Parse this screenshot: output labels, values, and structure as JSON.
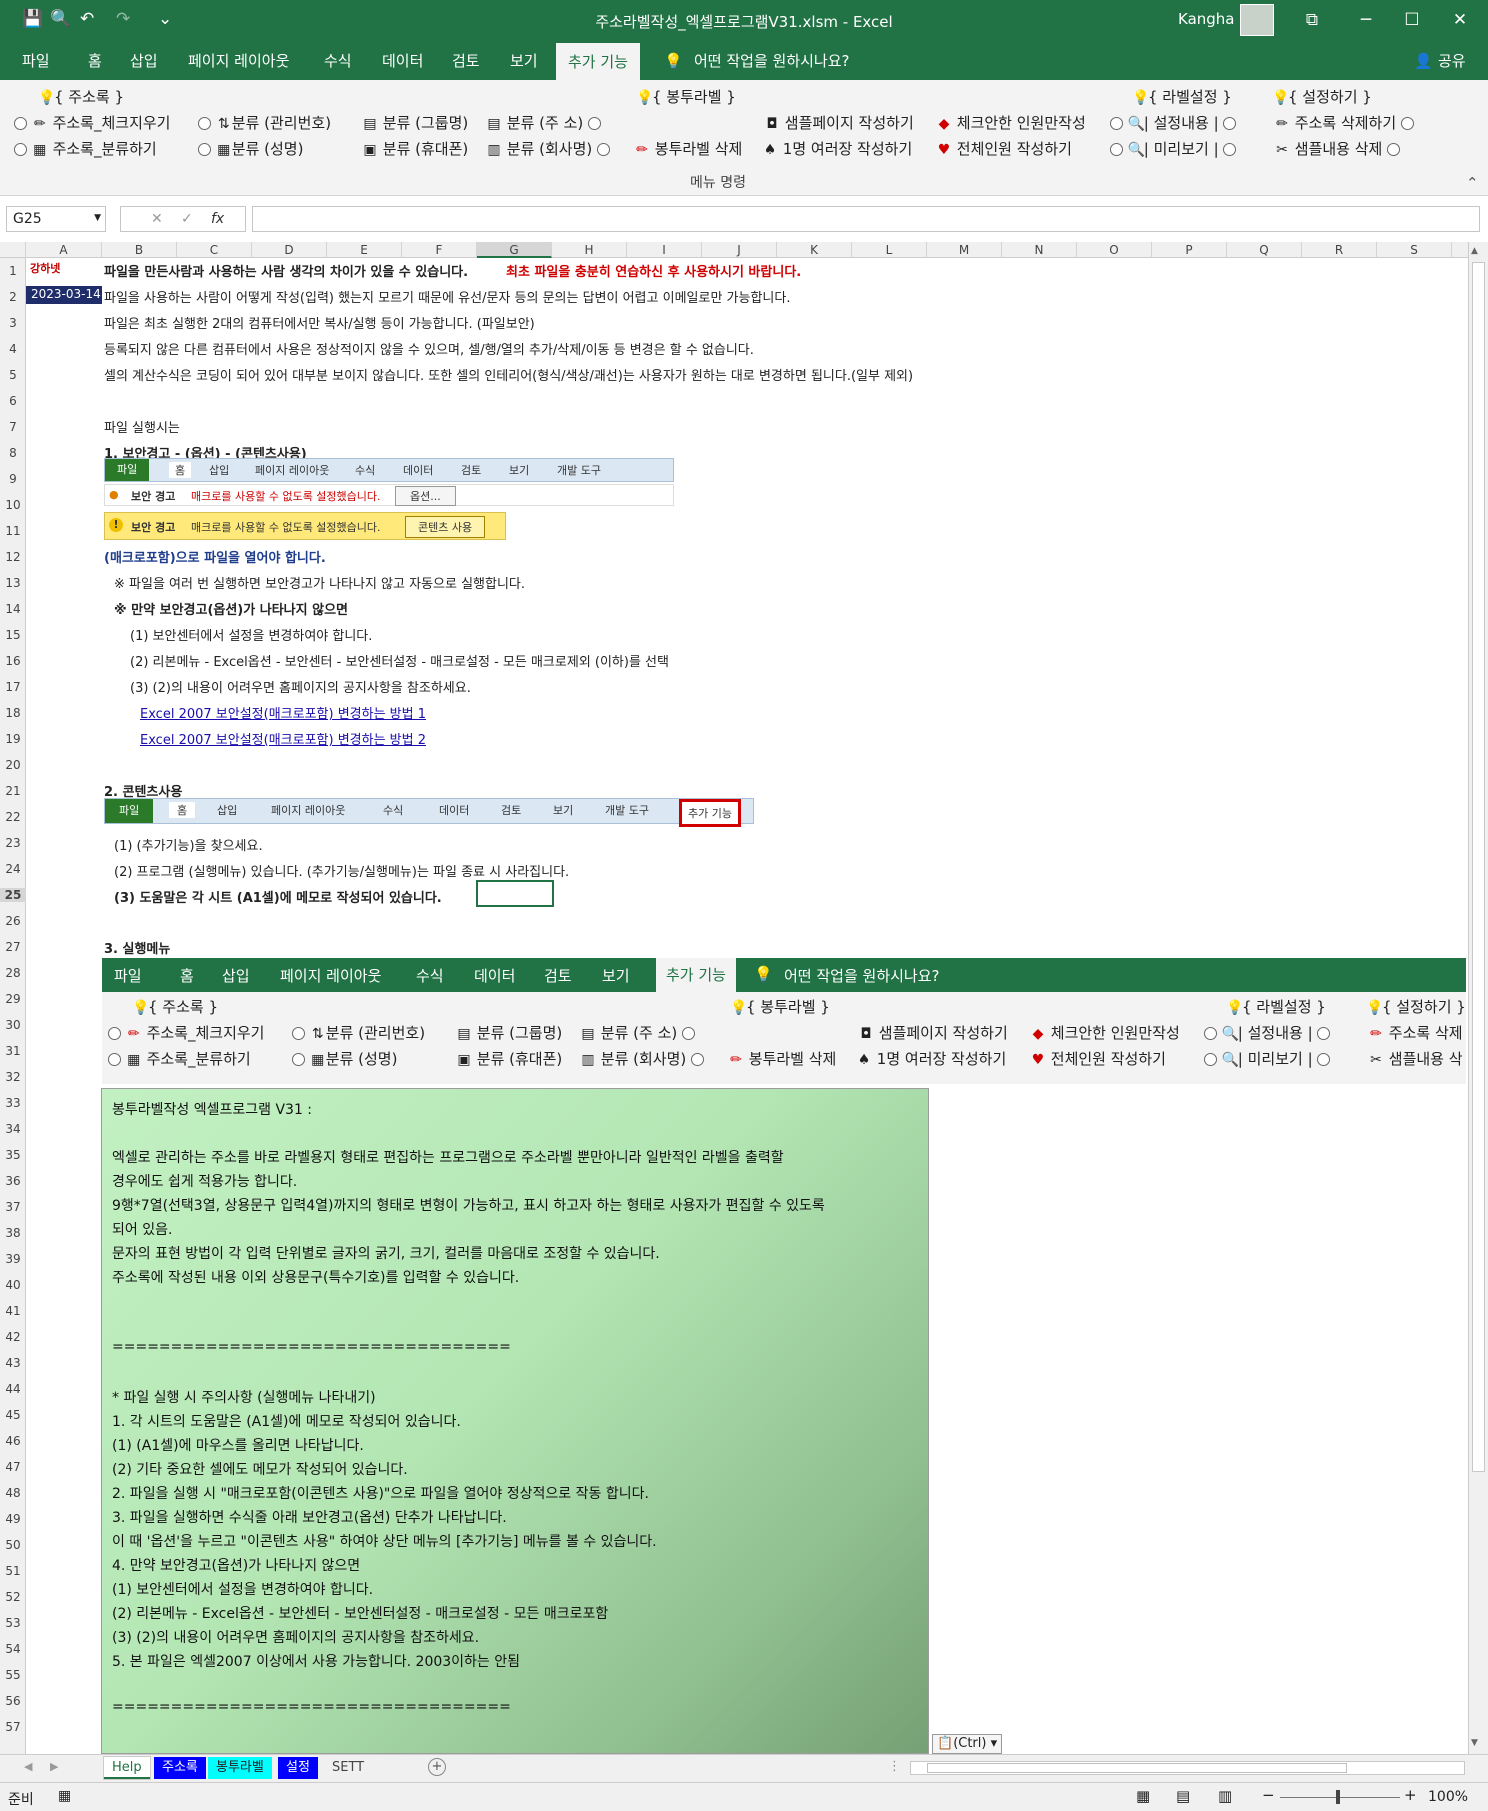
{
  "window": {
    "title": "주소라벨작성_엑셀프로그램V31.xlsm  -  Excel",
    "user": "Kangha",
    "minimize": "─",
    "maximize": "☐",
    "close": "✕",
    "ribbon_display": "⧉"
  },
  "quick_access": {
    "save": "💾",
    "preview": "🔍",
    "undo": "↶",
    "redo": "↷",
    "customize": "⌄"
  },
  "ribbon_tabs": [
    "파일",
    "홈",
    "삽입",
    "페이지 레이아웃",
    "수식",
    "데이터",
    "검토",
    "보기",
    "추가 기능"
  ],
  "tell_me": "어떤 작업을 원하시나요?",
  "share": "공유",
  "ribbon": {
    "group_headers": [
      "{ 주소록 }",
      "{ 봉투라벨 }",
      "{ 라벨설정 }",
      "{ 설정하기 }"
    ],
    "row1": [
      "주소록_체크지우기",
      "분류 (관리번호)",
      "분류 (그룹명)",
      "분류 (주    소)",
      "샘플페이지 작성하기",
      "체크안한 인원만작성",
      "| 설정내용 |",
      "주소록 삭제하기"
    ],
    "row2": [
      "주소록_분류하기",
      "분류 (성명)",
      "분류 (휴대폰)",
      "분류 (회사명)",
      "봉투라벨 삭제",
      "1명 여러장 작성하기",
      "전체인원 작성하기",
      "| 미리보기 |",
      "샘플내용 삭제"
    ],
    "group_label": "메뉴 명령"
  },
  "formula_bar": {
    "name_box": "G25",
    "cancel": "✕",
    "enter": "✓",
    "fx": "fx",
    "value": ""
  },
  "columns": [
    "A",
    "B",
    "C",
    "D",
    "E",
    "F",
    "G",
    "H",
    "I",
    "J",
    "K",
    "L",
    "M",
    "N",
    "O",
    "P",
    "Q",
    "R",
    "S"
  ],
  "rows": [
    "1",
    "2",
    "3",
    "4",
    "5",
    "6",
    "7",
    "8",
    "9",
    "10",
    "11",
    "12",
    "13",
    "14",
    "15",
    "16",
    "17",
    "18",
    "19",
    "20",
    "21",
    "22",
    "23",
    "24",
    "25",
    "26",
    "27",
    "28",
    "29",
    "30",
    "31",
    "32",
    "33",
    "34",
    "35",
    "36",
    "37",
    "38",
    "39",
    "40",
    "41",
    "42",
    "43",
    "44",
    "45",
    "46",
    "47",
    "48",
    "49",
    "50",
    "51",
    "52",
    "53",
    "54",
    "55",
    "56",
    "57"
  ],
  "sheet": {
    "logo": "강하넷",
    "date": "2023-03-14",
    "r1": "파일을 만든사람과 사용하는 사람 생각의 차이가 있을 수 있습니다.",
    "r1_red": "최초 파일을 충분히 연습하신 후 사용하시기 바랍니다.",
    "r2": "파일을 사용하는 사람이 어떻게 작성(입력) 했는지 모르기 때문에 유선/문자 등의 문의는 답변이 어렵고 이메일로만 가능합니다.",
    "r3": "파일은 최초 실행한 2대의 컴퓨터에서만 복사/실행 등이 가능합니다.  (파일보안)",
    "r4": "등록되지 않은 다른 컴퓨터에서 사용은 정상적이지 않을 수 있으며, 셀/행/열의 추가/삭제/이동 등 변경은 할 수 없습니다.",
    "r5": "셀의 계산수식은 코딩이 되어 있어 대부분 보이지 않습니다. 또한 셀의 인테리어(형식/색상/괘선)는 사용자가 원하는 대로 변경하면 됩니다.(일부 제외)",
    "r7": "파일 실행시는",
    "r8": "1. 보안경고 - (옵션) - (콘텐츠사용)",
    "mini1_tabs": [
      "파일",
      "홈",
      "삽입",
      "페이지 레이아웃",
      "수식",
      "데이터",
      "검토",
      "보기",
      "개발 도구"
    ],
    "mini1_warn": "보안 경고",
    "mini1_msg": "매크로를 사용할 수 없도록 설정했습니다.",
    "mini1_btn": "옵션...",
    "mini2_warn": "보안 경고",
    "mini2_msg": "매크로를 사용할 수 없도록 설정했습니다.",
    "mini2_btn": "콘텐츠 사용",
    "r12": "(매크로포함)으로 파일을 열어야 합니다.",
    "r13": "※ 파일을 여러 번 실행하면 보안경고가 나타나지 않고 자동으로 실행합니다.",
    "r14": "※ 만약 보안경고(옵션)가 나타나지 않으면",
    "r15": "(1) 보안센터에서 설정을 변경하여야 합니다.",
    "r16": "(2) 리본메뉴 - Excel옵션 - 보안센터 - 보안센터설정 - 매크로설정 - 모든 매크로제외 (이하)를 선택",
    "r17": "(3) (2)의 내용이 어려우면 홈페이지의 공지사항을 참조하세요.",
    "r18": "Excel 2007 보안설정(매크로포함) 변경하는 방법 1",
    "r19": "Excel 2007 보안설정(매크로포함) 변경하는 방법 2",
    "r21": "2. 콘텐츠사용",
    "mini3_tabs": [
      "파일",
      "홈",
      "삽입",
      "페이지 레이아웃",
      "수식",
      "데이터",
      "검토",
      "보기",
      "개발 도구",
      "추가 기능"
    ],
    "r23": "(1) (추가기능)을 찾으세요.",
    "r24": "(2) 프로그램 (실행메뉴) 있습니다. (추가기능/실행메뉴)는 파일 종료 시 사라집니다.",
    "r25": "(3) 도움말은 각 시트 (A1셀)에 메모로 작성되어 있습니다.",
    "r27": "3. 실행메뉴",
    "emb_tabs": [
      "파일",
      "홈",
      "삽입",
      "페이지 레이아웃",
      "수식",
      "데이터",
      "검토",
      "보기",
      "추가 기능"
    ],
    "emb_tell": "어떤 작업을 원하시나요?",
    "emb_headers": [
      "{ 주소록 }",
      "{ 봉투라벨 }",
      "{ 라벨설정 }",
      "{ 설정하기 }"
    ],
    "emb_row1": [
      "주소록_체크지우기",
      "분류 (관리번호)",
      "분류 (그룹명)",
      "분류 (주    소)",
      "샘플페이지 작성하기",
      "체크안한 인원만작성",
      "| 설정내용 |",
      "주소록 삭제"
    ],
    "emb_row2": [
      "주소록_분류하기",
      "분류 (성명)",
      "분류 (휴대폰)",
      "분류 (회사명)",
      "봉투라벨 삭제",
      "1명 여러장 작성하기",
      "전체인원 작성하기",
      "| 미리보기 |",
      "샘플내용 삭"
    ]
  },
  "note_box": [
    "봉투라벨작성 엑셀프로그램 V31 :",
    "",
    "엑셀로 관리하는 주소를 바로 라벨용지 형태로 편집하는 프로그램으로 주소라벨 뿐만아니라 일반적인 라벨을 출력할",
    "경우에도 쉽게 적용가능 합니다.",
    "9행*7열(선택3열, 상용문구 입력4열)까지의 형태로 변형이 가능하고, 표시 하고자 하는 형태로 사용자가 편집할 수 있도록",
    "되어 있음.",
    "문자의 표현 방법이 각 입력 단위별로 글자의 굵기, 크기, 컬러를 마음대로 조정할 수 있습니다.",
    "주소록에 작성된 내용 이외 상용문구(특수기호)를 입력할 수 있습니다.",
    "",
    "",
    "==================================",
    "",
    "* 파일 실행 시 주의사항 (실행메뉴 나타내기)",
    "1. 각 시트의 도움말은 (A1셀)에 메모로 작성되어 있습니다.",
    "  (1) (A1셀)에 마우스를 올리면 나타납니다.",
    "  (2) 기타 중요한 셀에도 메모가 작성되어 있습니다.",
    "2. 파일을 실행 시 \"매크로포함(이콘텐츠 사용)\"으로 파일을 열어야 정상적으로 작동 합니다.",
    "3. 파일을 실행하면 수식줄 아래 보안경고(옵션) 단추가 나타납니다.",
    "   이 때 '옵션'을 누르고 \"이콘텐츠 사용\" 하여야 상단 메뉴의 [추가기능] 메뉴를 볼 수 있습니다.",
    "4. 만약 보안경고(옵션)가 나타나지 않으면",
    "  (1) 보안센터에서 설정을 변경하여야 합니다.",
    "  (2) 리본메뉴 - Excel옵션 - 보안센터 - 보안센터설정 - 매크로설정 - 모든 매크로포함",
    "  (3) (2)의 내용이 어려우면 홈페이지의 공지사항을 참조하세요.",
    "5. 본 파일은 엑셀2007 이상에서 사용 가능합니다. 2003이하는 안됨",
    "",
    "=================================="
  ],
  "paste_options": "(Ctrl)",
  "sheet_tabs": [
    {
      "label": "Help",
      "bg": "#ffffff",
      "fg": "#217346"
    },
    {
      "label": "주소록",
      "bg": "#0000ff",
      "fg": "#ffffff"
    },
    {
      "label": "봉투라벨",
      "bg": "#00ffff",
      "fg": "#222222"
    },
    {
      "label": "설정",
      "bg": "#0000ff",
      "fg": "#ffffff"
    },
    {
      "label": "SETT",
      "bg": "#f0f0f0",
      "fg": "#444444"
    }
  ],
  "status": {
    "ready": "준비",
    "zoom": "100%"
  },
  "colors": {
    "excel_green": "#217346",
    "highlight_red": "#d00000",
    "date_bg": "#1f2d6b"
  }
}
